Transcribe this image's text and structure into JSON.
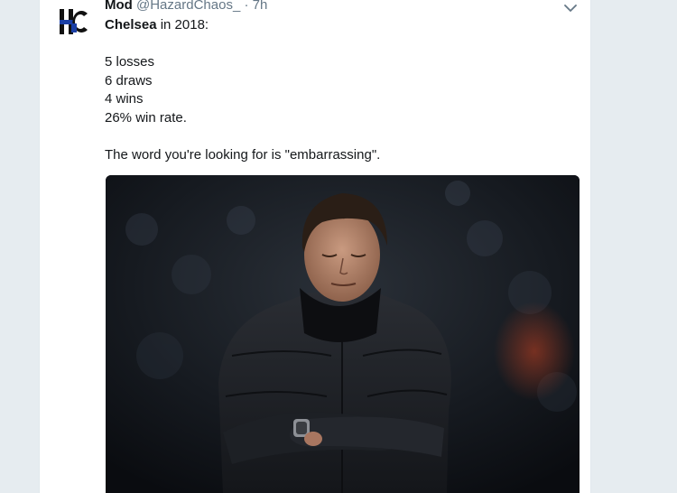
{
  "tweet": {
    "display_name": "Mod",
    "handle": "@HazardChaos_",
    "separator": "·",
    "time": "7h",
    "body": {
      "line1_bold": "Chelsea",
      "line1_rest": " in 2018:",
      "stats": [
        "5 losses",
        "6 draws",
        "4 wins",
        "26% win rate."
      ],
      "closing": "The word you're looking for is \"embarrassing\"."
    },
    "avatar_text": "HC",
    "caret_icon": "chevron-down-icon",
    "media": {
      "kind": "photo",
      "subject": "man in black puffer jacket with arms crossed, eyes closed"
    }
  },
  "colors": {
    "page_bg": "#e6ecf0",
    "card_bg": "#ffffff",
    "text": "#14171a",
    "secondary": "#657786",
    "avatar_blue": "#1a3fa6"
  }
}
